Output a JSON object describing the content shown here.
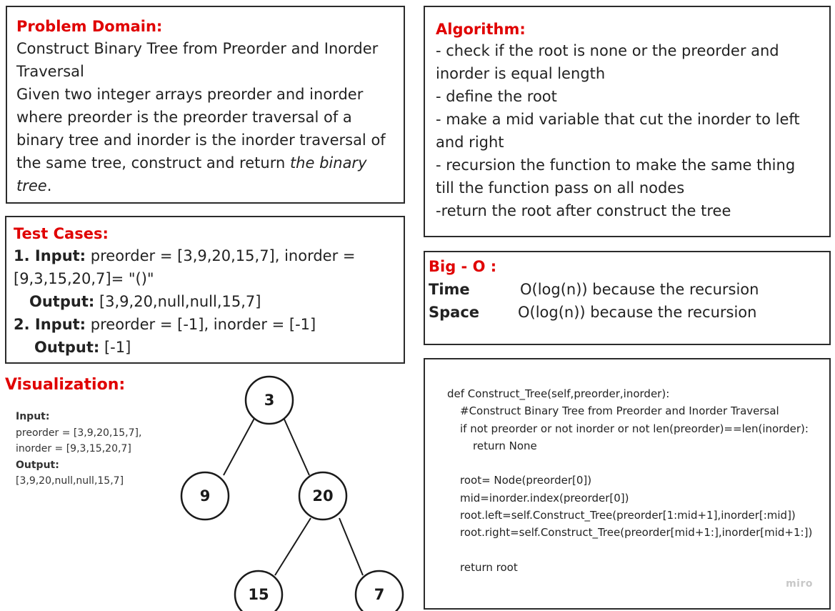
{
  "problem": {
    "heading": "Problem Domain:",
    "title_line1": "Construct Binary Tree from Preorder and Inorder",
    "title_line2": "Traversal",
    "desc_line1": "Given two integer arrays preorder and inorder",
    "desc_line2": "where preorder is the preorder traversal of a",
    "desc_line3": "binary tree and inorder is the inorder traversal of",
    "desc_line4_a": "the same tree, construct and return ",
    "desc_line4_b": "the binary",
    "desc_line5_a": "tree",
    "desc_line5_b": "."
  },
  "algorithm": {
    "heading": "Algorithm:",
    "lines": [
      "- check if the root is none or the preorder and",
      "inorder is equal length",
      "- define the root",
      "- make a mid variable that cut the inorder to left",
      "and right",
      "- recursion the function to make the same thing",
      "till the function pass on all nodes",
      "-return the root after construct the tree"
    ]
  },
  "tests": {
    "heading": "Test Cases:",
    "case1_label": "1. Input:",
    "case1_text_a": " preorder = [3,9,20,15,7], inorder =",
    "case1_text_b": "[9,3,15,20,7]= \"()\"",
    "case1_out_label": "Output:",
    "case1_out": " [3,9,20,null,null,15,7]",
    "case2_label": "2. Input:",
    "case2_text": " preorder = [-1], inorder = [-1]",
    "case2_out_label": "Output:",
    "case2_out": " [-1]"
  },
  "bigo": {
    "heading": "Big - O :",
    "time_label": "Time",
    "time_value": "O(log(n)) because the recursion",
    "space_label": "Space",
    "space_value": "O(log(n)) because the recursion"
  },
  "code": {
    "lines": [
      "def Construct_Tree(self,preorder,inorder):",
      "#Construct Binary Tree from Preorder and Inorder Traversal",
      "if not preorder or not inorder or not len(preorder)==len(inorder):",
      "return None",
      "root= Node(preorder[0])",
      "mid=inorder.index(preorder[0])",
      "root.left=self.Construct_Tree(preorder[1:mid+1],inorder[:mid])",
      "root.right=self.Construct_Tree(preorder[mid+1:],inorder[mid+1:])",
      "return root"
    ],
    "watermark": "miro"
  },
  "visualization": {
    "heading": "Visualization:",
    "input_label": "Input:",
    "input_line1": "preorder = [3,9,20,15,7],",
    "input_line2": "inorder = [9,3,15,20,7]",
    "output_label": "Output:",
    "output_value": "[3,9,20,null,null,15,7]",
    "nodes": [
      "3",
      "9",
      "20",
      "15",
      "7"
    ]
  }
}
